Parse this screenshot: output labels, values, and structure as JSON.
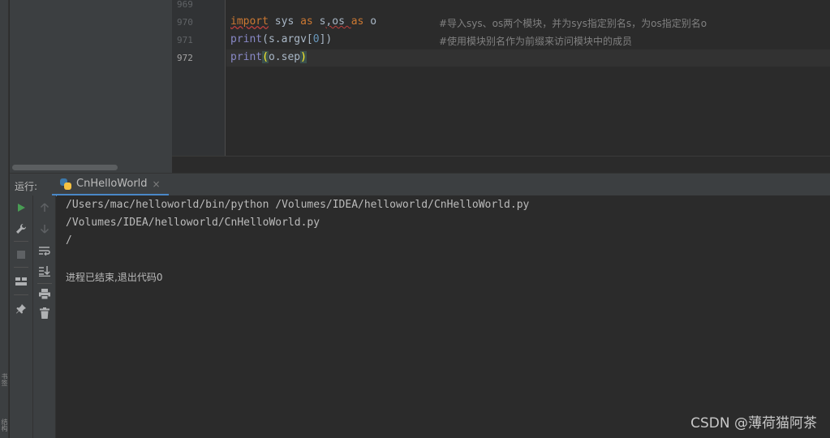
{
  "left_strip": {
    "label_top": "书签",
    "label_bottom": "结构"
  },
  "editor": {
    "lines": [
      {
        "number": "969"
      },
      {
        "number": "970",
        "comment": "#导入sys、os两个模块，并为sys指定别名s，为os指定别名o"
      },
      {
        "number": "971",
        "comment": "#使用模块别名作为前缀来访问模块中的成员"
      },
      {
        "number": "972"
      }
    ],
    "code": {
      "l970": {
        "kw_import": "import",
        "t1": " sys ",
        "kw_as1": "as",
        "t2": " s",
        "t3": ",os ",
        "kw_as2": "as",
        "t4": " o"
      },
      "l971": {
        "fn": "print",
        "t1": "(s.argv[",
        "num": "0",
        "t2": "])"
      },
      "l972": {
        "fn": "print",
        "open": "(",
        "t1": "o.sep",
        "close": ")"
      }
    }
  },
  "run_panel": {
    "label": "运行:",
    "tab_label": "CnHelloWorld",
    "tab_close": "×",
    "output": [
      "/Users/mac/helloworld/bin/python /Volumes/IDEA/helloworld/CnHelloWorld.py",
      "/Volumes/IDEA/helloworld/CnHelloWorld.py",
      "/"
    ],
    "exit_message": "进程已结束,退出代码0"
  },
  "icons": {
    "run": "play-icon",
    "settings": "wrench-icon",
    "stop": "stop-icon",
    "layout": "layout-icon",
    "pin": "pin-icon",
    "up": "arrow-up-icon",
    "down": "arrow-down-icon",
    "wrap": "soft-wrap-icon",
    "scroll_end": "scroll-to-end-icon",
    "print": "print-icon",
    "trash": "trash-icon"
  },
  "colors": {
    "accent": "#4a88c7",
    "run_green": "#499c54",
    "keyword": "#cc7832"
  },
  "watermark": "CSDN @薄荷猫阿茶"
}
